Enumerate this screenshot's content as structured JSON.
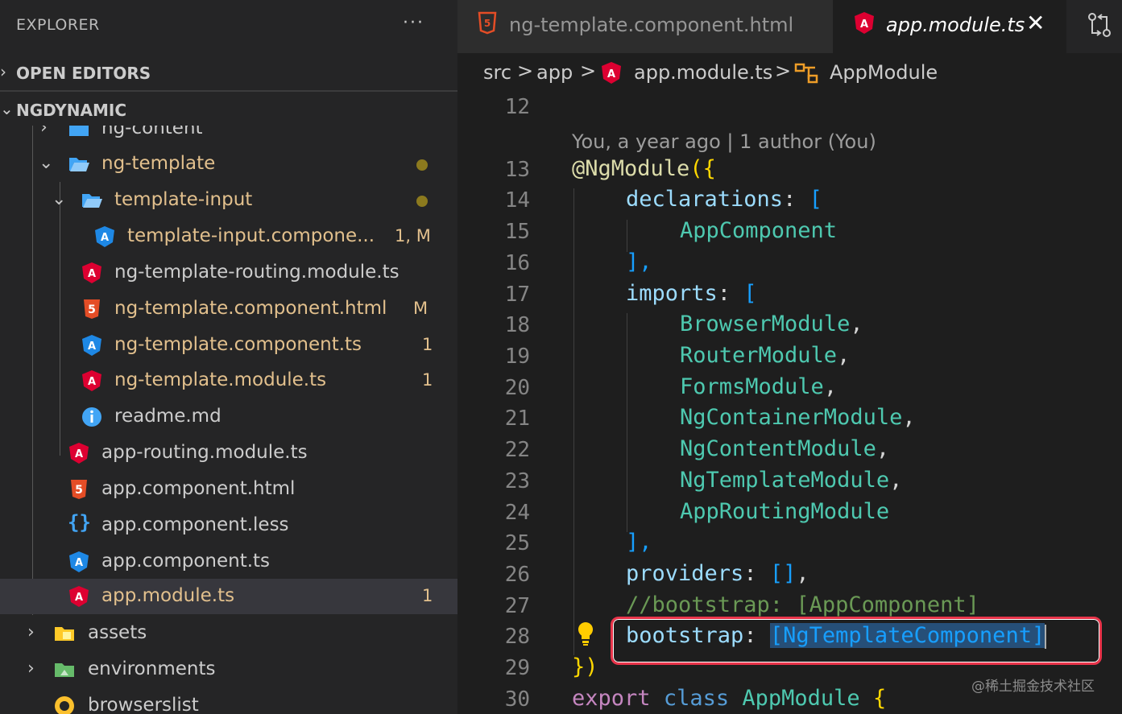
{
  "explorer": {
    "title": "EXPLORER",
    "more_label": "···",
    "open_editors_label": "OPEN EDITORS",
    "project_label": "NGDYNAMIC",
    "tree": [
      {
        "name": "ng-content",
        "icon": "folder-icon",
        "status": ""
      },
      {
        "name": "ng-template",
        "icon": "folder-open-icon",
        "status": "dot"
      },
      {
        "name": "template-input",
        "icon": "folder-open-icon",
        "status": "dot"
      },
      {
        "name": "template-input.compone...",
        "icon": "angular-component-icon",
        "status": "1, M"
      },
      {
        "name": "ng-template-routing.module.ts",
        "icon": "angular-icon",
        "status": ""
      },
      {
        "name": "ng-template.component.html",
        "icon": "html-icon",
        "status": "M"
      },
      {
        "name": "ng-template.component.ts",
        "icon": "angular-component-icon",
        "status": "1"
      },
      {
        "name": "ng-template.module.ts",
        "icon": "angular-icon",
        "status": "1"
      },
      {
        "name": "readme.md",
        "icon": "info-icon",
        "status": ""
      },
      {
        "name": "app-routing.module.ts",
        "icon": "angular-icon",
        "status": ""
      },
      {
        "name": "app.component.html",
        "icon": "html-icon",
        "status": ""
      },
      {
        "name": "app.component.less",
        "icon": "braces-icon",
        "status": ""
      },
      {
        "name": "app.component.ts",
        "icon": "angular-component-icon",
        "status": ""
      },
      {
        "name": "app.module.ts",
        "icon": "angular-icon",
        "status": "1"
      },
      {
        "name": "assets",
        "icon": "folder-assets-icon",
        "status": ""
      },
      {
        "name": "environments",
        "icon": "folder-env-icon",
        "status": ""
      },
      {
        "name": "browserslist",
        "icon": "browserslist-icon",
        "status": ""
      }
    ]
  },
  "tabs": [
    {
      "label": "ng-template.component.html",
      "icon": "html-icon"
    },
    {
      "label": "app.module.ts",
      "icon": "angular-icon",
      "close": "✕"
    }
  ],
  "breadcrumb": {
    "src": "src",
    "app": "app",
    "file": "app.module.ts",
    "symbol": "AppModule",
    "sep": ">"
  },
  "editor": {
    "blame": "You, a year ago | 1 author (You)",
    "line_numbers": [
      "12",
      "13",
      "14",
      "15",
      "16",
      "17",
      "18",
      "19",
      "20",
      "21",
      "22",
      "23",
      "24",
      "25",
      "26",
      "27",
      "28",
      "29",
      "30"
    ],
    "code": {
      "decorator": "@NgModule",
      "l13_open": "({",
      "declarations": "declarations",
      "colon": ":",
      "lbracket": "[",
      "app_component": "AppComponent",
      "close_bracket_comma": "],",
      "imports": "imports",
      "browser_module": "BrowserModule",
      "router_module": "RouterModule",
      "forms_module": "FormsModule",
      "ng_container_module": "NgContainerModule",
      "ng_content_module": "NgContentModule",
      "ng_template_module": "NgTemplateModule",
      "app_routing_module": "AppRoutingModule",
      "comma": ",",
      "providers": "providers",
      "providers_val": "[]",
      "comment": "//bootstrap: [AppComponent]",
      "bootstrap": "bootstrap",
      "bootstrap_val": "[NgTemplateComponent]",
      "close_decorator": "})",
      "export_kw": "export",
      "class_kw": "class",
      "class_name": "AppModule",
      "open_brace": "{"
    }
  },
  "watermark": "@稀土掘金技术社区",
  "colors": {
    "sidebar_bg": "#252526",
    "editor_bg": "#1e1e1e",
    "modified": "#e2c08d",
    "highlight_box": "#e8344a",
    "angular_red": "#dd0031",
    "angular_blue": "#1e88e5",
    "html_orange": "#e44d26"
  }
}
